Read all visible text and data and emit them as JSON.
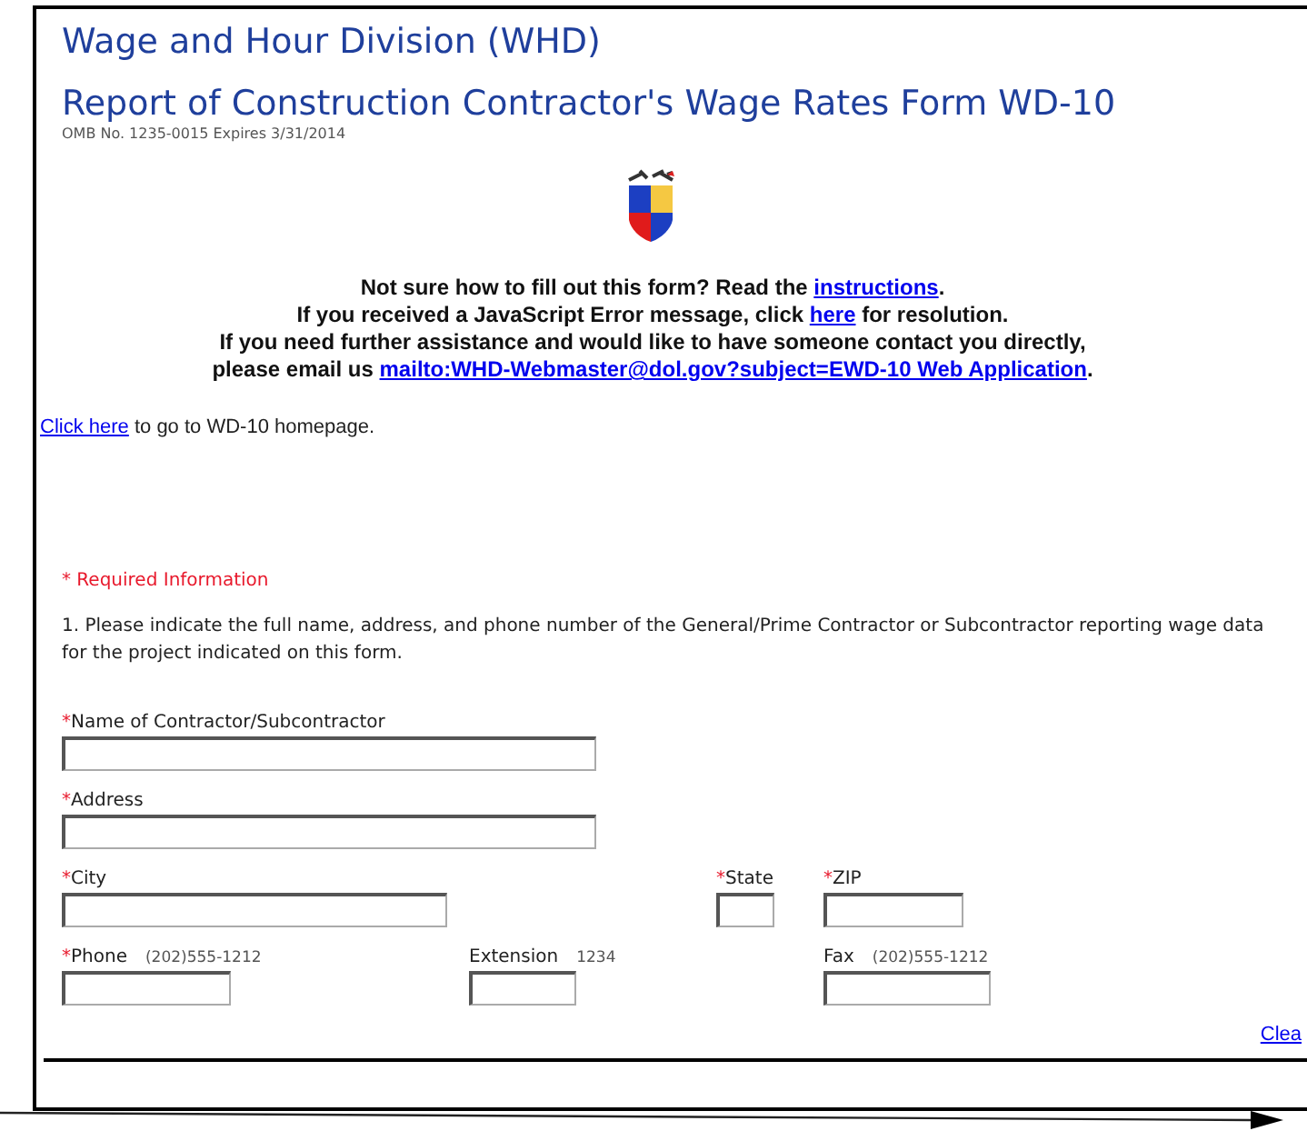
{
  "header": {
    "title": "Wage and Hour Division (WHD)",
    "subtitle": "Report of Construction Contractor's Wage Rates Form WD-10",
    "omb": "OMB No. 1235-0015 Expires 3/31/2014"
  },
  "help": [
    {
      "parts": [
        {
          "text": "Not sure how to fill out this form? Read the "
        },
        {
          "text": "instructions",
          "link": true
        },
        {
          "text": "."
        }
      ]
    },
    {
      "parts": [
        {
          "text": "If you received a JavaScript Error message, click "
        },
        {
          "text": "here",
          "link": true
        },
        {
          "text": " for resolution."
        }
      ]
    },
    {
      "parts": [
        {
          "text": "If you need further assistance and would like to have someone contact you directly,"
        }
      ]
    },
    {
      "parts": [
        {
          "text": "please email us "
        },
        {
          "text": "mailto:WHD-Webmaster@dol.gov?subject=EWD-10 Web Application",
          "link": true
        },
        {
          "text": "."
        }
      ]
    }
  ],
  "home": {
    "link": "Click here",
    "text": " to go to WD-10 homepage."
  },
  "required_note": "* Required Information",
  "instruction": "1. Please indicate the full name, address, and phone number of the General/Prime Contractor or Subcontractor reporting wage data for the project indicated on this form.",
  "required_mark": "*",
  "rows": [
    [
      {
        "label": "Name of Contractor/Subcontractor",
        "required": true
      }
    ],
    [
      {
        "label": "Address",
        "required": true
      }
    ],
    [
      {
        "label": "City",
        "required": true
      },
      {
        "label": "State",
        "required": true
      },
      {
        "label": "ZIP",
        "required": true
      }
    ],
    [
      {
        "label": "Phone",
        "required": true,
        "hint": "(202)555-1212"
      },
      {
        "label": "Extension",
        "required": false,
        "hint": "1234"
      },
      {
        "label": "Fax",
        "required": false,
        "hint": "(202)555-1212"
      }
    ]
  ],
  "clear_link": "Clea"
}
